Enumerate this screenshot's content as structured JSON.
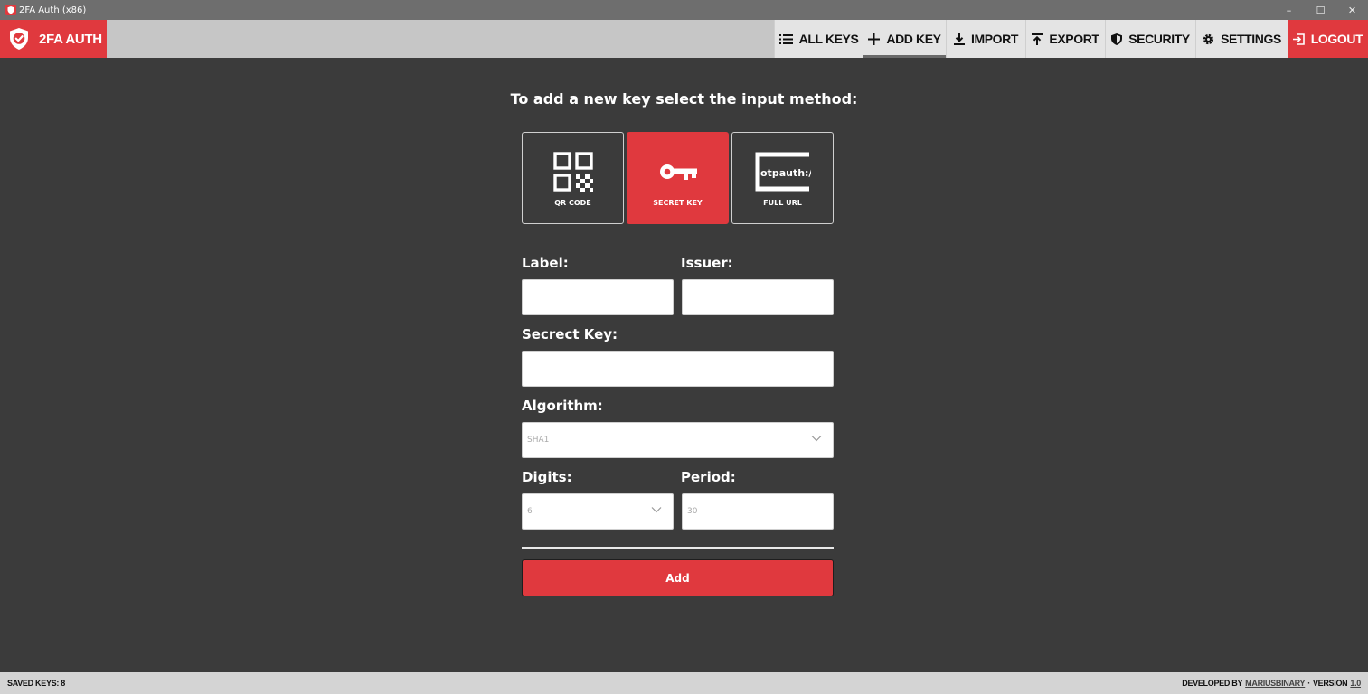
{
  "window": {
    "title": "2FA Auth (x86)",
    "controls": [
      "–",
      "☐",
      "✕"
    ]
  },
  "nav": {
    "brand": "2FA AUTH",
    "items": [
      {
        "label": "ALL KEYS",
        "icon": "list-icon"
      },
      {
        "label": "ADD KEY",
        "icon": "plus-icon",
        "active": true
      },
      {
        "label": "IMPORT",
        "icon": "download-icon"
      },
      {
        "label": "EXPORT",
        "icon": "upload-icon"
      },
      {
        "label": "SECURITY",
        "icon": "shield-icon"
      },
      {
        "label": "SETTINGS",
        "icon": "gear-icon"
      },
      {
        "label": "LOGOUT",
        "icon": "logout-icon"
      }
    ]
  },
  "main": {
    "heading": "To add a new key select the input method:",
    "methods": [
      {
        "label": "QR CODE",
        "icon": "qr-code-icon"
      },
      {
        "label": "SECRET KEY",
        "icon": "key-icon",
        "active": true
      },
      {
        "label": "FULL URL",
        "icon": "otpauth-url-icon",
        "icon_text": "otpauth://"
      }
    ],
    "form": {
      "label_label": "Label:",
      "issuer_label": "Issuer:",
      "secret_label": "Secrect Key:",
      "algorithm_label": "Algorithm:",
      "algorithm_value": "SHA1",
      "digits_label": "Digits:",
      "digits_value": "6",
      "period_label": "Period:",
      "period_placeholder": "30",
      "add_label": "Add"
    }
  },
  "status": {
    "saved_keys": "SAVED KEYS: 8",
    "developed_by": "DEVELOPED BY",
    "developer": "MARIUSBINARY",
    "sep": "·",
    "version_label": "VERSION",
    "version": "1.0"
  },
  "colors": {
    "accent": "#e0393e",
    "background": "#3b3b3b",
    "nav": "#e4e4e4"
  }
}
